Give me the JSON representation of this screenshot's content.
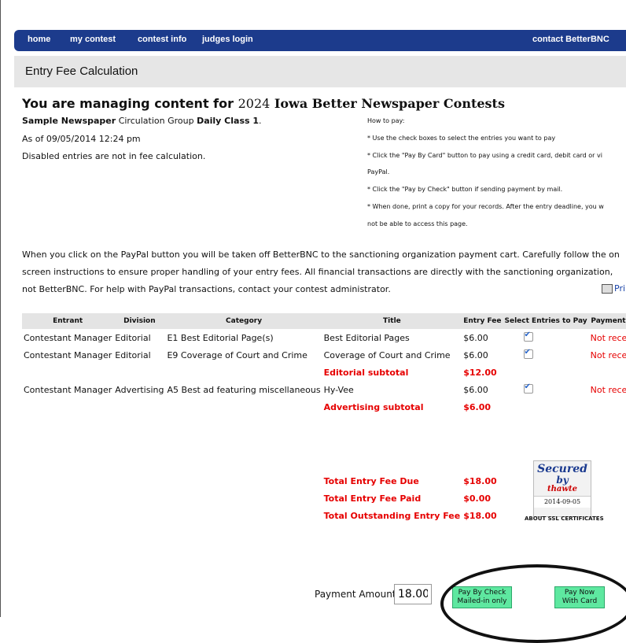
{
  "nav": {
    "items": [
      "home",
      "my contest",
      "contest info",
      "judges login"
    ],
    "contact": "contact BetterBNC"
  },
  "page_title": "Entry Fee Calculation",
  "heading": {
    "prefix": "You are managing content for",
    "year": "2024",
    "contest": "Iowa Better Newspaper Contests"
  },
  "paper": {
    "name": "Sample Newspaper",
    "circ_label": "Circulation Group",
    "group": "Daily Class 1",
    "asof": "As of 09/05/2014 12:24 pm",
    "disabled_note": "Disabled entries are not in fee calculation."
  },
  "howto": [
    "How to pay:",
    "* Use the check boxes to select the entries you want to pay",
    "* Click the \"Pay By Card\" button to pay using a credit card, debit card or vi",
    "PayPal.",
    "* Click the \"Pay by Check\" button if sending payment by mail.",
    "* When done, print a copy for your records. After the entry deadline, you w",
    "not be able to access this page."
  ],
  "paypal_note": "When you click on the PayPal button you will be taken off BetterBNC to the sanctioning organization payment cart. Carefully follow the on screen instructions to ensure proper handling of your entry fees. All financial transactions are directly with the sanctioning organization, not BetterBNC. For help with PayPal transactions, contact your contest administrator.",
  "print_label": "Pri",
  "table": {
    "headers": [
      "Entrant",
      "Division",
      "Category",
      "Title",
      "Entry Fee",
      "Select Entries to Pay",
      "Payment Stat"
    ],
    "rows": [
      {
        "entrant": "Contestant Manager",
        "division": "Editorial",
        "category": "E1 Best Editorial Page(s)",
        "title": "Best Editorial Pages",
        "fee": "$6.00",
        "checked": true,
        "status": "Not received"
      },
      {
        "entrant": "Contestant Manager",
        "division": "Editorial",
        "category": "E9 Coverage of Court and Crime",
        "title": "Coverage of Court and Crime",
        "fee": "$6.00",
        "checked": true,
        "status": "Not received"
      },
      {
        "subtotal_label": "Editorial subtotal",
        "subtotal": "$12.00"
      },
      {
        "entrant": "Contestant Manager",
        "division": "Advertising",
        "category": "A5 Best ad featuring miscellaneous",
        "title": "Hy-Vee",
        "fee": "$6.00",
        "checked": true,
        "status": "Not received"
      },
      {
        "subtotal_label": "Advertising subtotal",
        "subtotal": "$6.00"
      }
    ]
  },
  "totals": {
    "due_label": "Total Entry Fee Due",
    "due": "$18.00",
    "paid_label": "Total Entry Fee Paid",
    "paid": "$0.00",
    "outstanding_label": "Total Outstanding Entry Fee",
    "outstanding": "$18.00"
  },
  "seal": {
    "line1": "Secured",
    "line2": "by",
    "line3": "thawte",
    "date": "2014-09-05",
    "caption": "ABOUT SSL CERTIFICATES"
  },
  "payment": {
    "label": "Payment Amount",
    "value": "18.00",
    "check_btn_line1": "Pay By Check",
    "check_btn_line2": "Mailed-in only",
    "card_btn_line1": "Pay Now",
    "card_btn_line2": "With Card"
  },
  "colors": {
    "nav_bg": "#1c3b8c",
    "alert_red": "#e60000",
    "button_green": "#5ee8a0"
  }
}
